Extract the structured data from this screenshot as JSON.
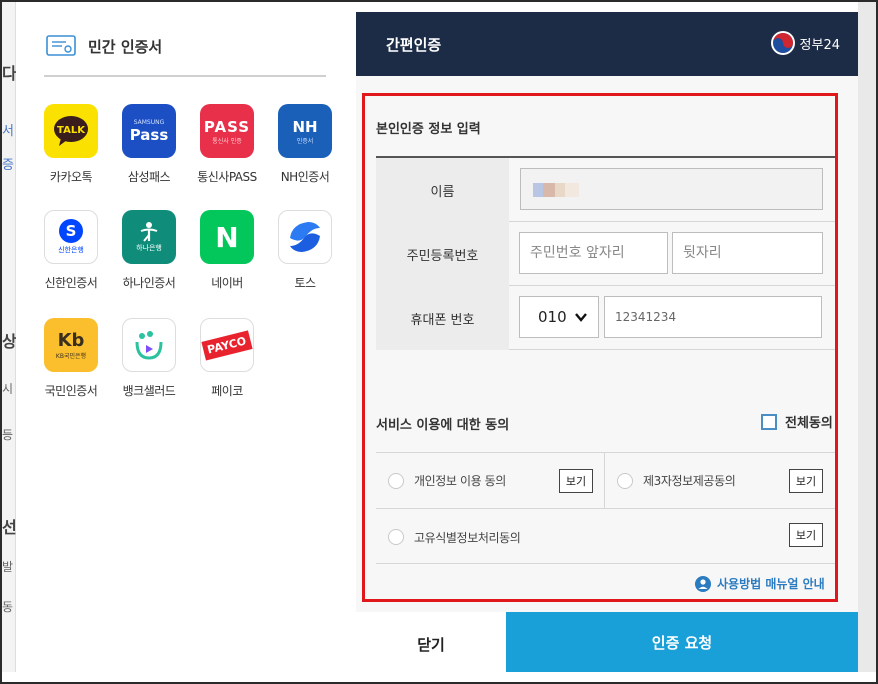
{
  "left_panel": {
    "title": "민간 인증서",
    "apps": [
      {
        "name": "kakao",
        "label": "카카오톡",
        "logo_text": "TALK",
        "color": "#fae100"
      },
      {
        "name": "samsung-pass",
        "label": "삼성패스",
        "logo_text": "Pass",
        "logo_sub": "SAMSUNG",
        "color": "#1d4fc4"
      },
      {
        "name": "telecom-pass",
        "label": "통신사PASS",
        "logo_text": "PASS",
        "logo_sub": "통신사 인증",
        "color": "#e8304a"
      },
      {
        "name": "nh",
        "label": "NH인증서",
        "logo_text": "NH",
        "logo_sub": "인증서",
        "color": "#1a5fb8"
      },
      {
        "name": "shinhan",
        "label": "신한인증서",
        "logo_text": "S",
        "logo_sub": "신한은행",
        "color": "#ffffff"
      },
      {
        "name": "hana",
        "label": "하나인증서",
        "logo_text": "하나은행",
        "color": "#0f8d7a"
      },
      {
        "name": "naver",
        "label": "네이버",
        "logo_text": "N",
        "color": "#03c75a"
      },
      {
        "name": "toss",
        "label": "토스",
        "logo_text": "",
        "color": "#ffffff"
      },
      {
        "name": "kb",
        "label": "국민인증서",
        "logo_text": "Kb",
        "logo_sub": "KB국민은행",
        "color": "#fbbf2d"
      },
      {
        "name": "bankshell",
        "label": "뱅크샐러드",
        "logo_text": "",
        "color": "#ffffff"
      },
      {
        "name": "payco",
        "label": "페이코",
        "logo_text": "PAYCO",
        "color": "#ffffff"
      }
    ]
  },
  "right_panel": {
    "title": "간편인증",
    "gov_logo_text": "정부24"
  },
  "form": {
    "section_title": "본인인증 정보 입력",
    "name_label": "이름",
    "rrn_label": "주민등록번호",
    "rrn_front_placeholder": "주민번호 앞자리",
    "rrn_back_placeholder": "뒷자리",
    "phone_label": "휴대폰 번호",
    "phone_prefix": "010",
    "phone_number_value": "12341234"
  },
  "agreements": {
    "section_title": "서비스 이용에 대한 동의",
    "all_agree_label": "전체동의",
    "items": [
      {
        "label": "개인정보 이용 동의",
        "view": "보기"
      },
      {
        "label": "제3자정보제공동의",
        "view": "보기"
      },
      {
        "label": "고유식별정보처리동의",
        "view": "보기"
      }
    ]
  },
  "manual_link_label": "사용방법 매뉴얼 안내",
  "buttons": {
    "close": "닫기",
    "request": "인증 요청"
  },
  "colors": {
    "header_navy": "#1c2b46",
    "highlight_red": "#e0181c",
    "request_blue": "#1aa0d8",
    "link_blue": "#2b7bc0"
  }
}
